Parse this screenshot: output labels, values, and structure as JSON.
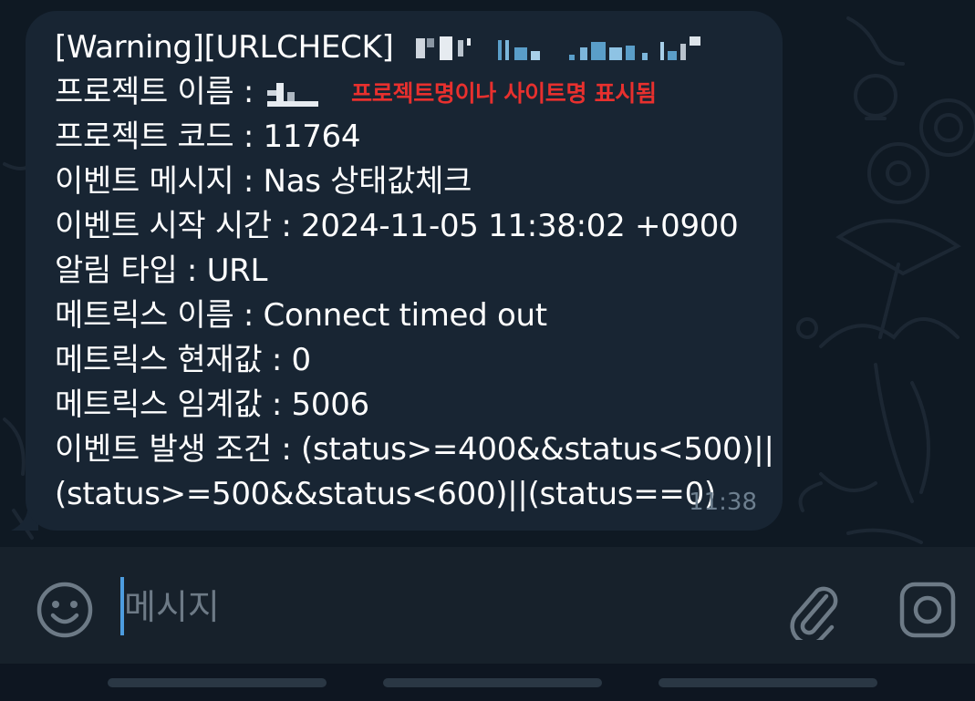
{
  "message": {
    "line_1": "[Warning][URLCHECK]",
    "line_2_label": "프로젝트 이름 :",
    "annotation": "프로젝트명이나 사이트명 표시됨",
    "line_3": "프로젝트 코드 : 11764",
    "line_4": "이벤트 메시지 : Nas 상태값체크",
    "line_5": "이벤트 시작 시간 : 2024-11-05 11:38:02 +0900",
    "line_6": "알림 타입 : URL",
    "line_7": "메트릭스 이름 : Connect timed out",
    "line_8": "메트릭스 현재값 : 0",
    "line_9": "메트릭스 임계값 : 5006",
    "line_10": "이벤트 발생 조건 : (status>=400&&status<500)||",
    "line_11": "(status>=500&&status<600)||(status==0)",
    "time": "11:38"
  },
  "composer": {
    "placeholder": "메시지",
    "emoji_icon": "smiley-icon",
    "attach_icon": "paperclip-icon",
    "camera_icon": "instagram-camera-icon"
  },
  "colors": {
    "bubble": "#182533",
    "background": "#0f1923",
    "annotation_red": "#e8302e",
    "cursor": "#4d9de0"
  }
}
